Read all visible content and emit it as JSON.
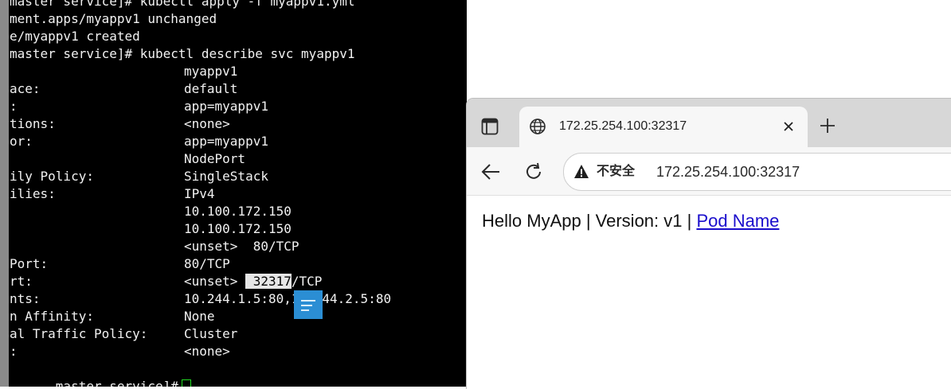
{
  "terminal": {
    "lines": [
      {
        "key": "master service]# kubectl apply -f myappv1.yml",
        "val": ""
      },
      {
        "key": "ment.apps/myappv1 unchanged",
        "val": ""
      },
      {
        "key": "e/myappv1 created",
        "val": ""
      },
      {
        "key": "master service]# kubectl describe svc myappv1",
        "val": ""
      },
      {
        "key": "",
        "val": "myappv1"
      },
      {
        "key": "ace:",
        "val": "default"
      },
      {
        "key": ":",
        "val": "app=myappv1"
      },
      {
        "key": "tions:",
        "val": "<none>"
      },
      {
        "key": "or:",
        "val": "app=myappv1"
      },
      {
        "key": "",
        "val": "NodePort"
      },
      {
        "key": "ily Policy:",
        "val": "SingleStack"
      },
      {
        "key": "ilies:",
        "val": "IPv4"
      },
      {
        "key": "",
        "val": "10.100.172.150"
      },
      {
        "key": "",
        "val": "10.100.172.150"
      },
      {
        "key": "",
        "val": "<unset>  80/TCP"
      },
      {
        "key": "Port:",
        "val": "80/TCP"
      },
      {
        "key": "rt:",
        "val": ""
      },
      {
        "key": "nts:",
        "val": "10.244.1.5:80,10.244.2.5:80"
      },
      {
        "key": "n Affinity:",
        "val": "None"
      },
      {
        "key": "al Traffic Policy:",
        "val": "Cluster"
      },
      {
        "key": ":",
        "val": "<none>"
      }
    ],
    "nodeport_line": {
      "prefix": "<unset> ",
      "highlight": " 32317",
      "suffix": "/TCP"
    },
    "prompt": "master service]#"
  },
  "browser": {
    "tab_title": "172.25.254.100:32317",
    "security_label": "不安全",
    "url": "172.25.254.100:32317",
    "page": {
      "text": "Hello MyApp | Version: v1 | ",
      "link": "Pod Name"
    }
  },
  "icons": {
    "tab_actions": "tab-actions-icon",
    "globe": "globe-icon",
    "close": "close-icon",
    "new_tab": "plus-icon",
    "back": "arrow-left-icon",
    "reload": "reload-icon",
    "warning": "warning-icon",
    "note": "note-icon"
  }
}
